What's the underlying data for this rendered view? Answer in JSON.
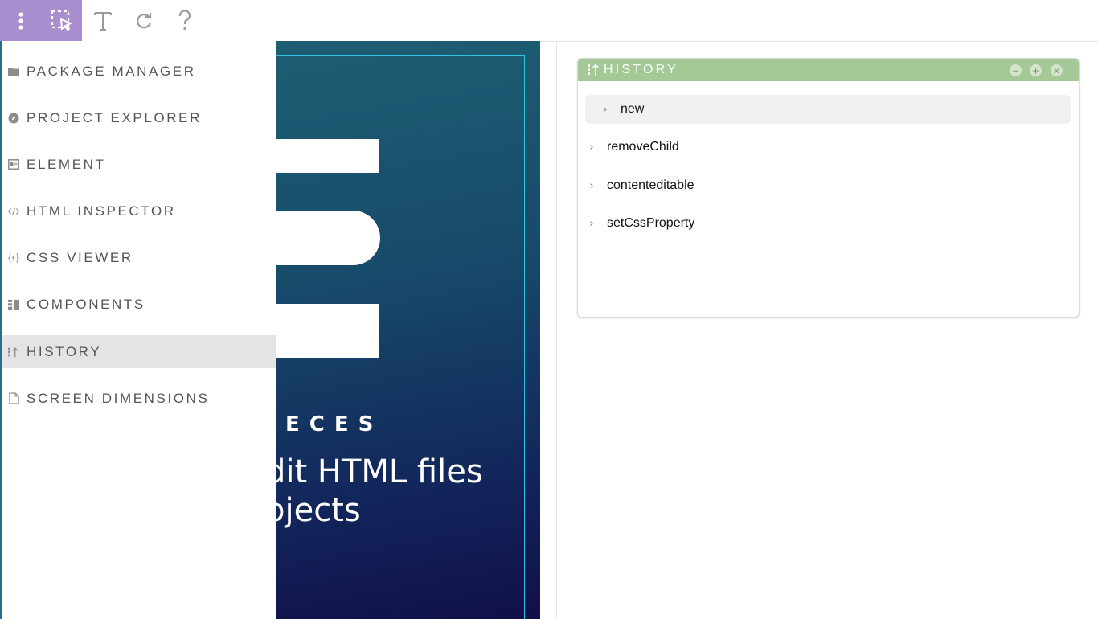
{
  "toolbar": {
    "buttons": [
      {
        "name": "more-menu",
        "icon": "vertical-dots-icon",
        "active": true
      },
      {
        "name": "select-element",
        "icon": "selection-pointer-icon"
      },
      {
        "name": "text-tool",
        "icon": "text-icon"
      },
      {
        "name": "refresh",
        "icon": "refresh-icon"
      },
      {
        "name": "help",
        "icon": "question-mark-icon"
      }
    ]
  },
  "menu": {
    "items": [
      {
        "label": "PACKAGE MANAGER",
        "icon": "folder-icon"
      },
      {
        "label": "PROJECT EXPLORER",
        "icon": "compass-icon"
      },
      {
        "label": "ELEMENT",
        "icon": "element-icon"
      },
      {
        "label": "HTML INSPECTOR",
        "icon": "code-icon"
      },
      {
        "label": "CSS VIEWER",
        "icon": "css-brace-icon"
      },
      {
        "label": "COMPONENTS",
        "icon": "components-icon"
      },
      {
        "label": "HISTORY",
        "icon": "history-icon",
        "active": true
      },
      {
        "label": "SCREEN DIMENSIONS",
        "icon": "document-icon"
      }
    ]
  },
  "canvas": {
    "subtitle": "ECES",
    "text_line1": "dit HTML files",
    "text_line2": "ojects"
  },
  "history_panel": {
    "title": "HISTORY",
    "minimize_symbol": "−",
    "maximize_symbol": "+",
    "close_symbol": "×",
    "chevron": "›",
    "entries": [
      {
        "label": "new",
        "selected": true
      },
      {
        "label": "removeChild"
      },
      {
        "label": "contenteditable"
      },
      {
        "label": "setCssProperty"
      }
    ]
  },
  "colors": {
    "toolbar_active": "#a98fd0",
    "panel_header": "#a4c996",
    "canvas_gradient_top": "#1f6274",
    "canvas_gradient_bottom": "#110f48",
    "canvas_frame": "#2ec4e6",
    "menu_active": "#e4e4e4"
  }
}
